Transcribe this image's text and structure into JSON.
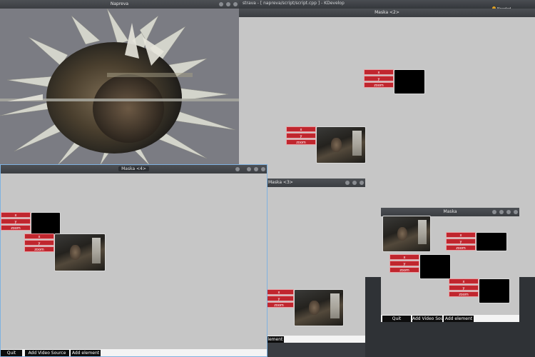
{
  "kdevelop": {
    "title": "strava - [ napreva/script/script.cpp ] - KDevelop",
    "status": "Needed"
  },
  "windows": {
    "napreva": {
      "title": "Napreva"
    },
    "maska2": {
      "title": "Maska <2>"
    },
    "maska3": {
      "title": "Maska <3>"
    },
    "maska4": {
      "title": "Maska <4>"
    },
    "maska": {
      "title": "Maska"
    }
  },
  "element_buttons": {
    "x": "x",
    "y": "y",
    "zoom": "zoom"
  },
  "toolbar": {
    "quit": "Quit",
    "add_video_source": "Add Video Source",
    "add_element": "Add element",
    "element_partial": "element"
  },
  "colors": {
    "red_button": "#c0262e",
    "canvas": "#c6c6c6",
    "titlebar": "#3b3e42",
    "active_border": "#7fb2e0"
  }
}
